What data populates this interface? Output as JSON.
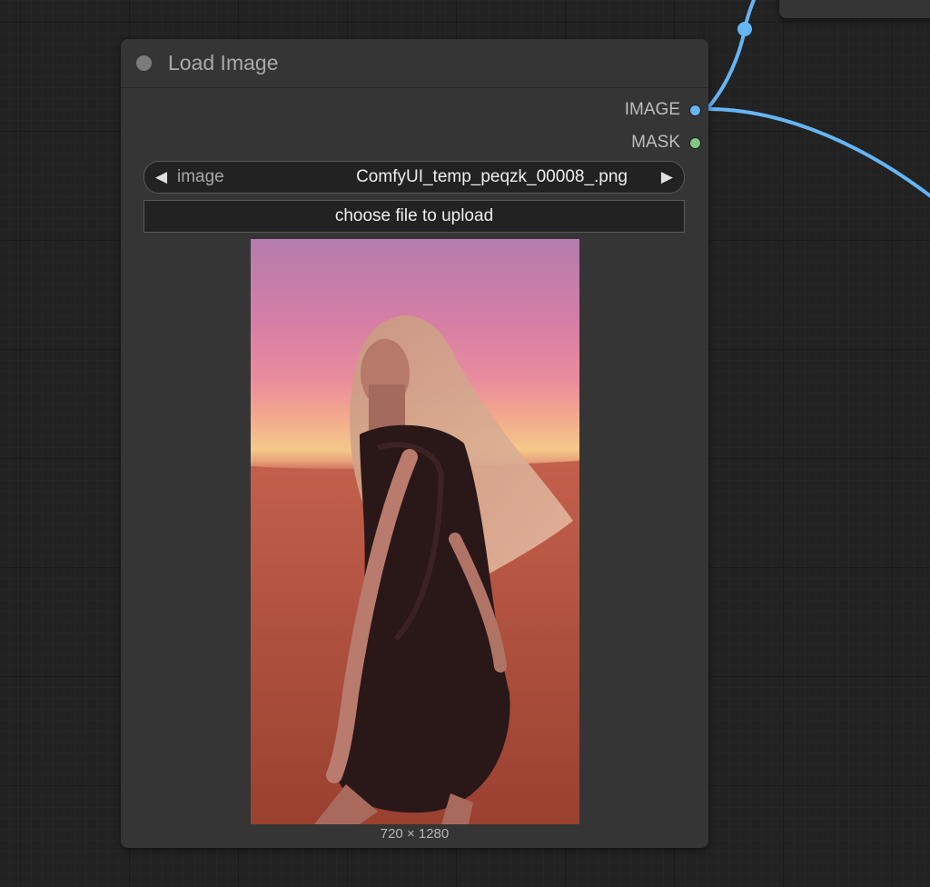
{
  "node": {
    "title": "Load Image",
    "outputs": [
      {
        "label": "IMAGE",
        "color": "#64b5f6"
      },
      {
        "label": "MASK",
        "color": "#81c784"
      }
    ],
    "image_widget": {
      "name": "image",
      "value": "ComfyUI_temp_peqzk_00008_.png",
      "left_arrow": "◀",
      "right_arrow": "▶"
    },
    "upload_button": "choose file to upload",
    "preview": {
      "subject": "photo of a woman in a dark dress standing in a desert at sunset",
      "dimensions": "720 × 1280"
    }
  },
  "colors": {
    "canvas_bg": "#222222",
    "node_bg": "#353535",
    "wire": "#64b5f6"
  }
}
